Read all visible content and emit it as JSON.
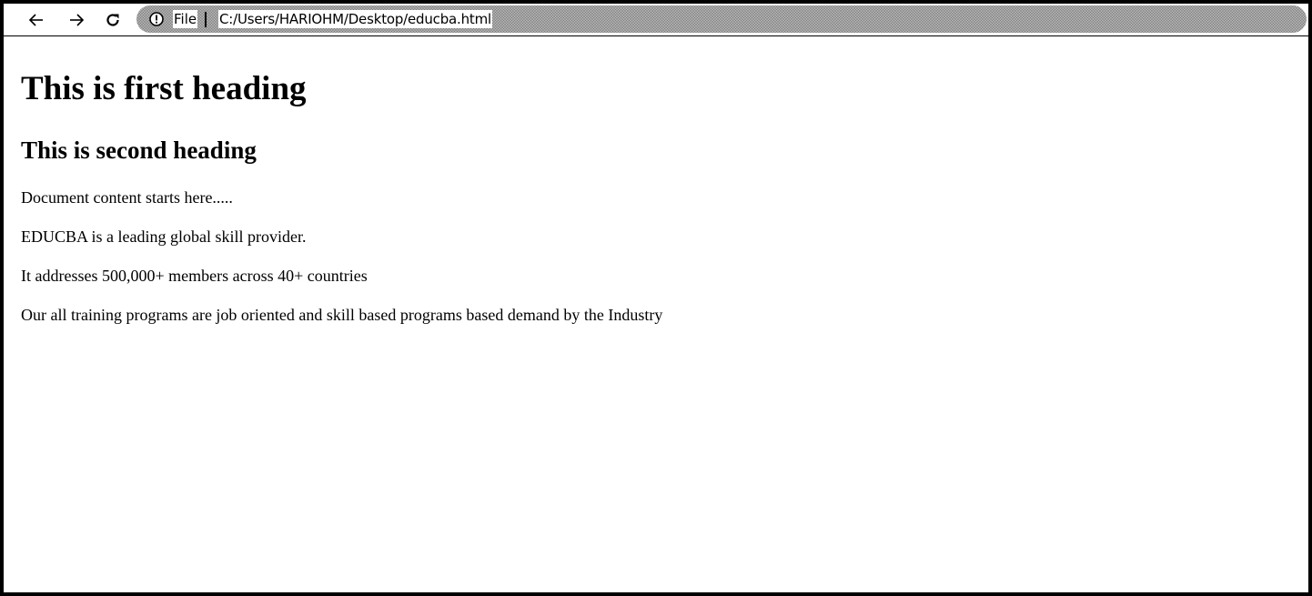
{
  "browser": {
    "toolbar": {
      "back_icon": "arrow-left-icon",
      "forward_icon": "arrow-right-icon",
      "reload_icon": "reload-icon"
    },
    "address_bar": {
      "info_icon": "info-circle-icon",
      "scheme_label": "File",
      "url": "C:/Users/HARIOHM/Desktop/educba.html"
    }
  },
  "page": {
    "heading1": "This is first heading",
    "heading2": "This is second heading",
    "paragraphs": [
      "Document content starts here.....",
      "EDUCBA is a leading global skill provider.",
      "It addresses 500,000+ members across 40+ countries",
      "Our all training programs are job oriented and skill based programs based demand by the Industry"
    ]
  },
  "colors": {
    "frame_border": "#000000",
    "background": "#ffffff",
    "text": "#000000"
  }
}
